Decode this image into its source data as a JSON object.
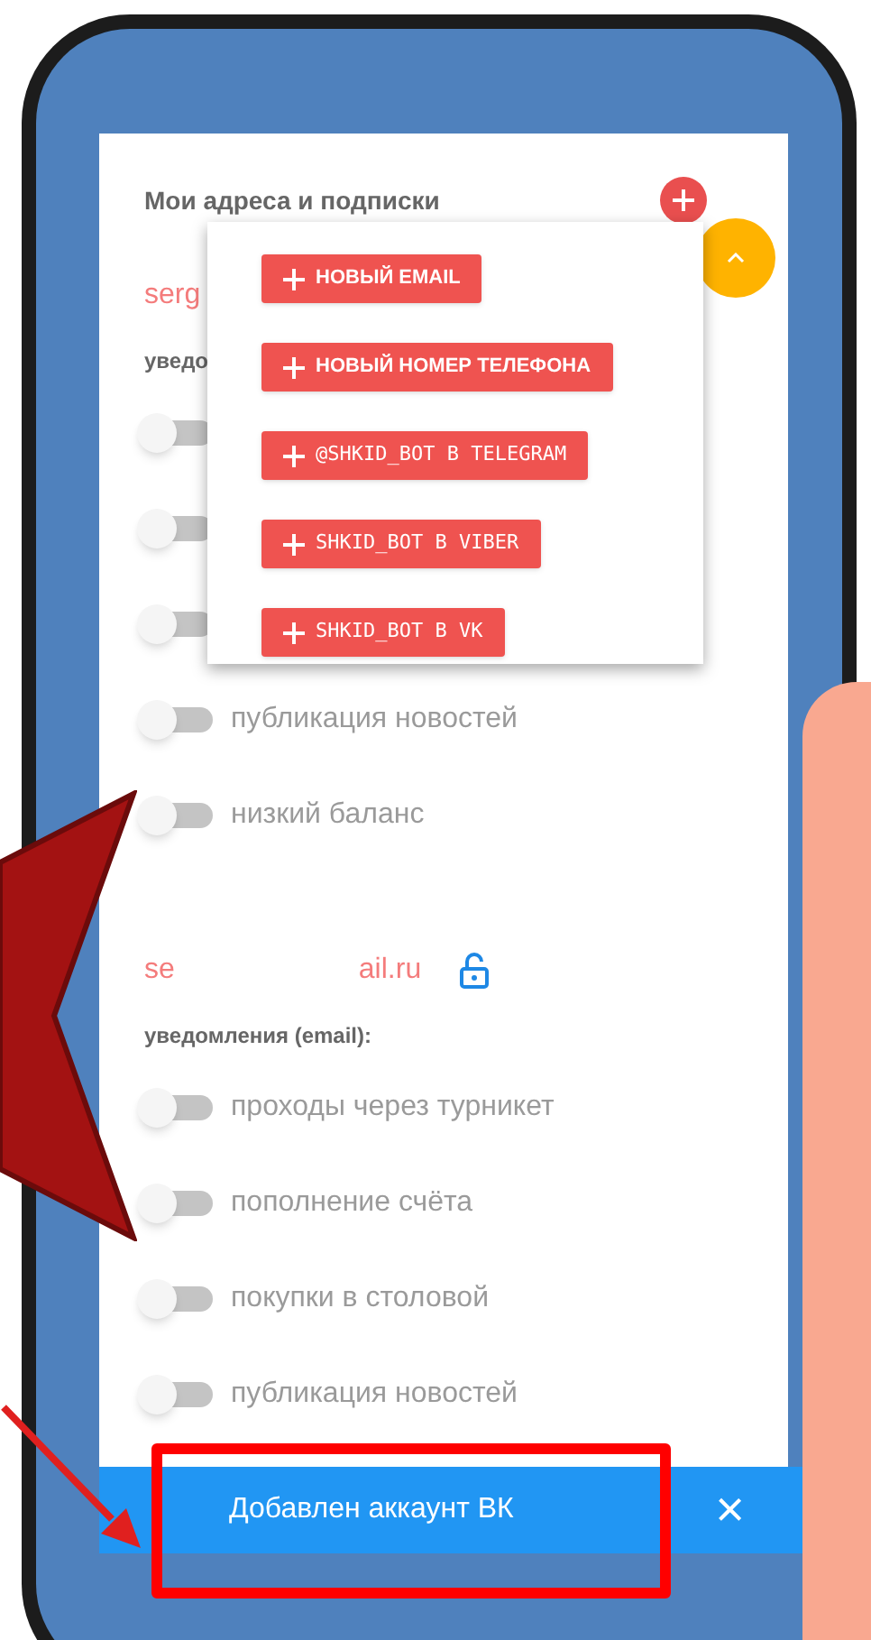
{
  "screen": {
    "title": "Мои адреса и подписки",
    "addresses": [
      {
        "kind": "plain",
        "email": "serg",
        "notifications_heading": "уведо",
        "toggles": [
          {
            "on": false
          },
          {
            "on": false
          },
          {
            "on": false
          },
          {
            "label": "публикация новостей",
            "on": false
          },
          {
            "label": "низкий баланс",
            "on": false
          }
        ]
      },
      {
        "kind": "masked",
        "email_start": "se",
        "email_end": "ail.ru",
        "locked": false,
        "notifications_heading": "уведомления (email):",
        "toggles": [
          {
            "label": "проходы через турникет",
            "on": false
          },
          {
            "label": "пополнение счёта",
            "on": false
          },
          {
            "label": "покупки в столовой",
            "on": false
          },
          {
            "label": "публикация новостей",
            "on": false
          }
        ]
      }
    ]
  },
  "add_menu": {
    "items": [
      {
        "kind": "plain",
        "label": "НОВЫЙ EMAIL"
      },
      {
        "kind": "plain",
        "label": "НОВЫЙ НОМЕР ТЕЛЕФОНА"
      },
      {
        "kind": "mono",
        "label": "@SHKID_BOT В TELEGRAM"
      },
      {
        "kind": "mono",
        "label": "SHKID_BOT В VIBER"
      },
      {
        "kind": "mono",
        "label": "SHKID_BOT В VK"
      }
    ]
  },
  "snackbar": {
    "message": "Добавлен аккаунт ВК",
    "close": "×"
  }
}
